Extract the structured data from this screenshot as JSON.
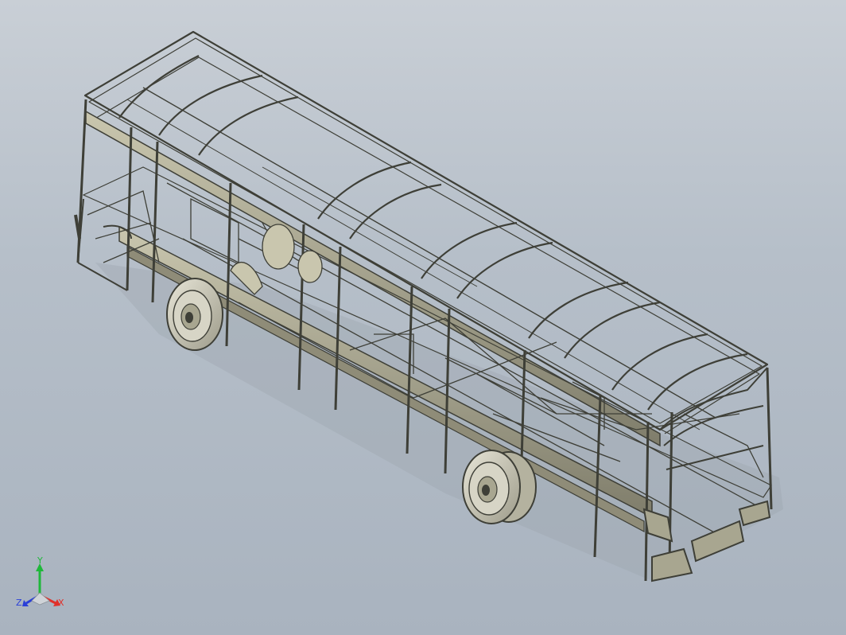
{
  "viewport": {
    "background_top": "#c9cfd6",
    "background_bottom": "#a9b3bf"
  },
  "model": {
    "frame_color": "#3e3f37",
    "panel_color": "#a8a690",
    "panel_light_color": "#c9c6ae",
    "wheel_color": "#d7d5c6",
    "shadow_color": "#8a8f95"
  },
  "triad": {
    "x_label": "X",
    "y_label": "Y",
    "z_label": "Z",
    "x_color": "#e0302a",
    "y_color": "#1fb83a",
    "z_color": "#2a3fd8"
  }
}
